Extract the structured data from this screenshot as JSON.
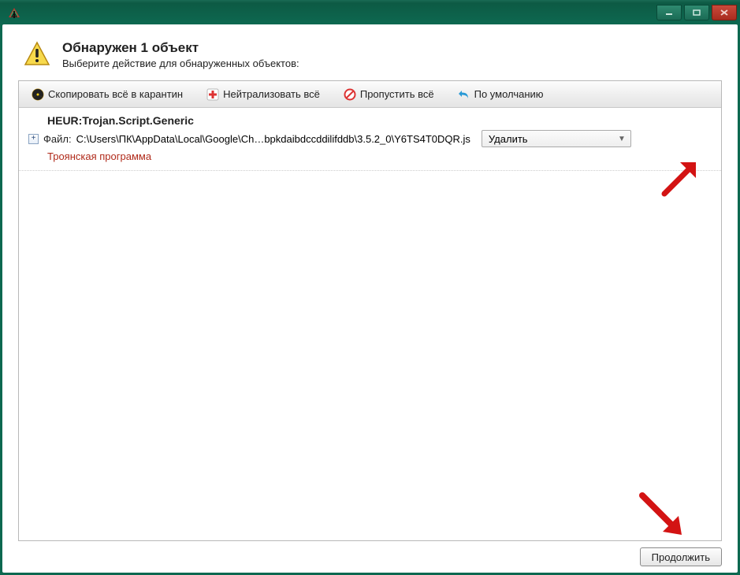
{
  "header": {
    "title": "Обнаружен 1  объект",
    "subtitle": "Выберите действие для обнаруженных объектов:"
  },
  "toolbar": {
    "quarantine": "Скопировать всё в карантин",
    "neutralize": "Нейтрализовать всё",
    "skip": "Пропустить всё",
    "defaults": "По умолчанию"
  },
  "threats": [
    {
      "name": "HEUR:Trojan.Script.Generic",
      "file_label": "Файл:",
      "path": "C:\\Users\\ПК\\AppData\\Local\\Google\\Ch…bpkdaibdccddilifddb\\3.5.2_0\\Y6TS4T0DQR.js",
      "action_selected": "Удалить",
      "verdict": "Троянская программа"
    }
  ],
  "footer": {
    "continue": "Продолжить"
  },
  "colors": {
    "frame": "#0d6850",
    "danger_text": "#b02a1a"
  }
}
